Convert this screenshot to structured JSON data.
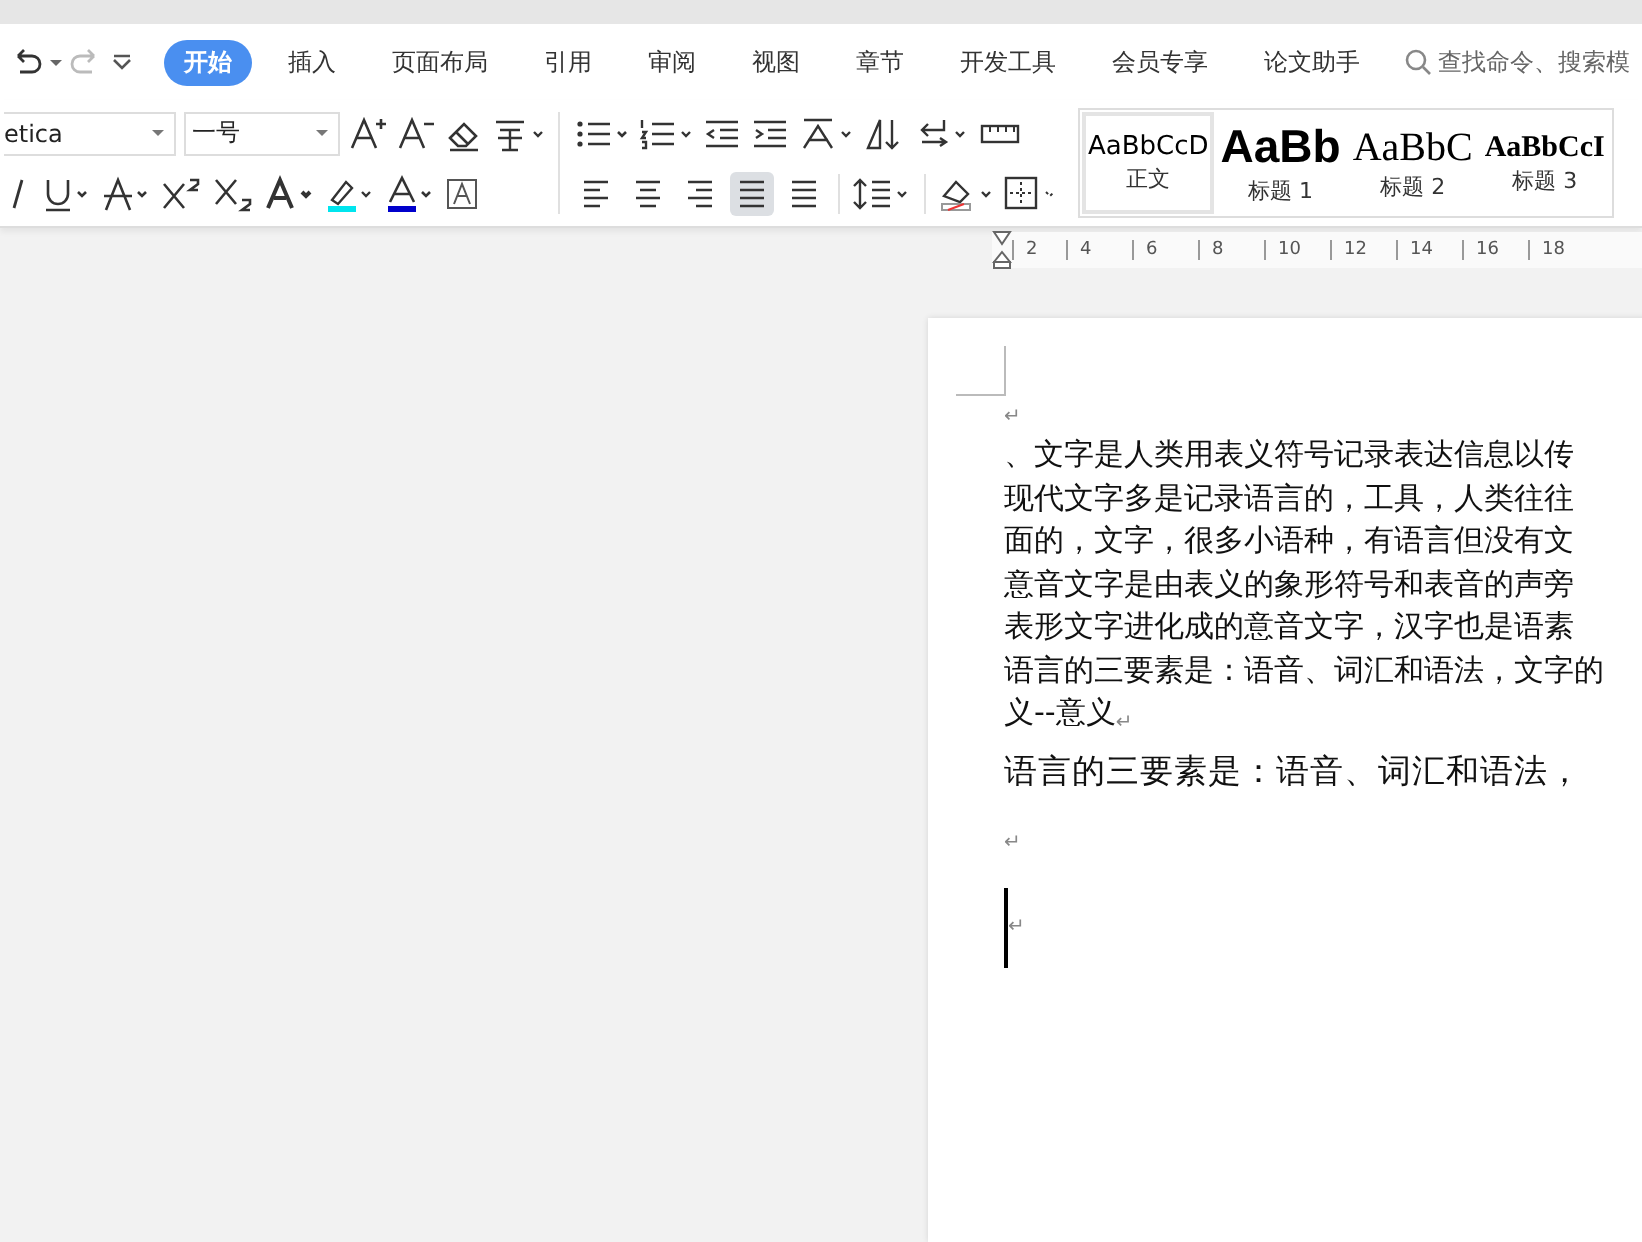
{
  "menu_tabs": [
    {
      "label": "开始",
      "selected": true
    },
    {
      "label": "插入",
      "selected": false
    },
    {
      "label": "页面布局",
      "selected": false
    },
    {
      "label": "引用",
      "selected": false
    },
    {
      "label": "审阅",
      "selected": false
    },
    {
      "label": "视图",
      "selected": false
    },
    {
      "label": "章节",
      "selected": false
    },
    {
      "label": "开发工具",
      "selected": false
    },
    {
      "label": "会员专享",
      "selected": false
    },
    {
      "label": "论文助手",
      "selected": false
    }
  ],
  "search": {
    "placeholder": "查找命令、搜索模"
  },
  "font": {
    "name": "etica",
    "size": "一号"
  },
  "align_buttons": [
    {
      "kind": "left",
      "selected": false
    },
    {
      "kind": "center",
      "selected": false
    },
    {
      "kind": "right",
      "selected": false
    },
    {
      "kind": "justify",
      "selected": true
    },
    {
      "kind": "distribute",
      "selected": false
    }
  ],
  "styles": [
    {
      "kind": "normal",
      "preview": "AaBbCcD",
      "name": "正文",
      "selected": true
    },
    {
      "kind": "h1",
      "preview": "AaBb",
      "name": "标题 1",
      "selected": false
    },
    {
      "kind": "h2",
      "preview": "AaBbC",
      "name": "标题 2",
      "selected": false
    },
    {
      "kind": "h3",
      "preview": "AaBbCcI",
      "name": "标题 3",
      "selected": false
    }
  ],
  "ruler": [
    "2",
    "4",
    "6",
    "8",
    "10",
    "12",
    "14",
    "16",
    "18"
  ],
  "paragraphs": [
    {
      "kind": "empty",
      "mark": "↵"
    },
    {
      "kind": "body",
      "lines": [
        "、文字是人类用表义符号记录表达信息以传",
        "现代文字多是记录语言的，工具，人类往往",
        "面的，文字，很多小语种，有语言但没有文",
        "意音文字是由表义的象形符号和表音的声旁",
        "表形文字进化成的意音文字，汉字也是语素",
        "语言的三要素是：语音、词汇和语法，文字的",
        "义--意义"
      ],
      "mark": "↵"
    },
    {
      "kind": "large",
      "lines": [
        "语言的三要素是：语音、词汇和语法，"
      ]
    },
    {
      "kind": "empty",
      "mark": "↵"
    },
    {
      "kind": "cursor",
      "mark": "↵"
    }
  ]
}
